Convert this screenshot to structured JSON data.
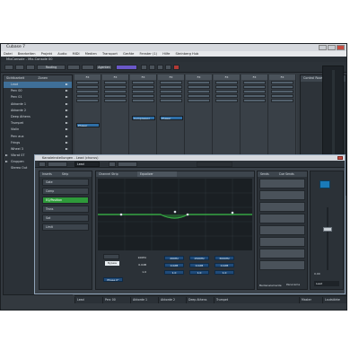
{
  "app": {
    "title": "Cubase 7"
  },
  "menu": [
    "Datei",
    "Bearbeiten",
    "Projekt",
    "Audio",
    "MIDI",
    "Medien",
    "Transport",
    "Geräte",
    "Fenster (1)",
    "Hilfe",
    "Steinberg Hub"
  ],
  "mixer": {
    "title": "MixConsole - Mix-Console 00",
    "toolbar": {
      "routing_label": "Routing",
      "agenten_label": "Agenten"
    },
    "left_tabs": [
      "Sichtbarkeit",
      "Zonen"
    ],
    "left_items": [
      "Lead",
      "Perc 00",
      "Perc 01",
      "Akkorde 1",
      "Akkorde 2",
      "Deep Athens",
      "Trumpet",
      "Violin",
      "Perc aux",
      "Frings",
      "Wheel 3",
      "Vibrat 07",
      "Gruppen",
      "Stereo Out"
    ],
    "strips": [
      {
        "name": "FX",
        "insert": ""
      },
      {
        "name": "FX",
        "insert": ""
      },
      {
        "name": "FX",
        "insert": "Compressor"
      },
      {
        "name": "FX",
        "insert": "Phaser"
      },
      {
        "name": "FX",
        "insert": ""
      },
      {
        "name": "FX",
        "insert": ""
      },
      {
        "name": "FX",
        "insert": ""
      },
      {
        "name": "FX",
        "insert": ""
      }
    ],
    "first_insert": "Phaser",
    "right_tabs": [
      "Control Room",
      "Meter"
    ],
    "bottom_names": [
      "Lead",
      "Perc 00",
      "Akkorde 1",
      "Akkorde 2",
      "Deep Athens",
      "Trumpet"
    ],
    "bottom_right": [
      "Master",
      "Lautstärke"
    ]
  },
  "dialog": {
    "title": "Kanaleinstellungen - Lead (chorus)",
    "channel_name": "Lead",
    "tabs": [
      "Inserts",
      "Strip"
    ],
    "strip_modules": [
      "Gate",
      "Comp",
      "EQ/Position",
      "Trans",
      "Sat",
      "Limit"
    ],
    "active_module": "EQ/Position",
    "eq_tabs": [
      "Channel Strip",
      "Equalizer"
    ],
    "eq_values": [
      [
        "100Hz",
        "200Hz",
        "1500Hz",
        "3000Hz"
      ],
      [
        "0.0dB",
        "0.0dB",
        "0.0dB",
        "0.0dB"
      ],
      [
        "1.0",
        "1.0",
        "1.0",
        "1.0"
      ]
    ],
    "eq_label_1": "Bypass",
    "eq_label_2": "Phase 0°",
    "sends_title": "Sends",
    "sends_col2": "Cue Sends",
    "fader_value": "0.00",
    "bottom_left": "Bedienelemente",
    "bottom_right": "Panorama",
    "bottom_fader": "Lead"
  },
  "colors": {
    "accent_green": "#2e9a3a",
    "insert_blue": "#2e6ea6",
    "selection_blue": "#3f6f98"
  }
}
